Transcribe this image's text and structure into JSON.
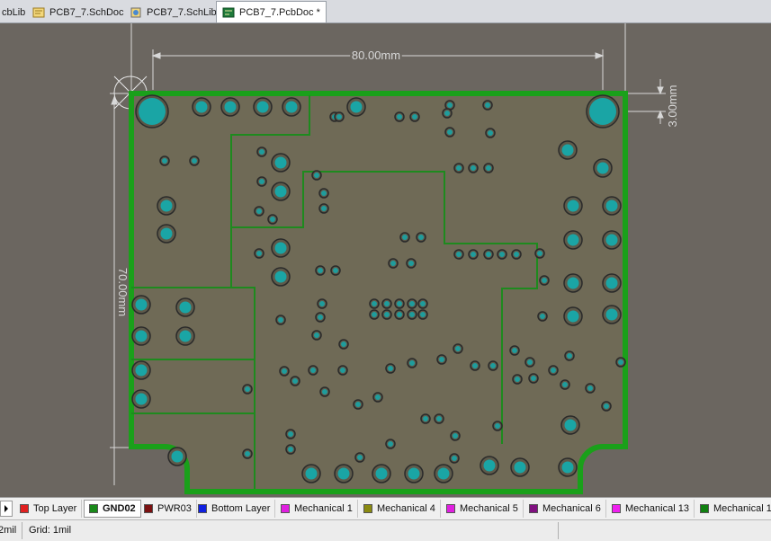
{
  "tabs": [
    {
      "label": "cbLib",
      "icon": "pcb-library-icon",
      "active": false
    },
    {
      "label": "PCB7_7.SchDoc",
      "icon": "schematic-doc-icon",
      "active": false
    },
    {
      "label": "PCB7_7.SchLib",
      "icon": "schematic-library-icon",
      "active": false
    },
    {
      "label": "PCB7_7.PcbDoc *",
      "icon": "pcb-doc-icon",
      "active": true
    }
  ],
  "dimensions": {
    "width": "80.00mm",
    "height": "70.00mm",
    "hole_offset": "3.00mm"
  },
  "colors": {
    "canvas": "#6b6660",
    "board": "#6f6a56",
    "outline": "#1aa01a",
    "plane_split": "#1e8a1e",
    "pad": "#1aa5a5",
    "via": "#1f9c9c",
    "dimension": "#d8d8d8"
  },
  "layers": [
    {
      "label": "Top Layer",
      "color": "#e02020",
      "active": false
    },
    {
      "label": "GND02",
      "color": "#1a8a1a",
      "active": true
    },
    {
      "label": "PWR03",
      "color": "#7a1010",
      "active": false
    },
    {
      "label": "Bottom Layer",
      "color": "#1020e0",
      "active": false
    },
    {
      "label": "Mechanical 1",
      "color": "#e020e0",
      "active": false
    },
    {
      "label": "Mechanical 4",
      "color": "#8a8a10",
      "active": false
    },
    {
      "label": "Mechanical 5",
      "color": "#e020e0",
      "active": false
    },
    {
      "label": "Mechanical 6",
      "color": "#801080",
      "active": false
    },
    {
      "label": "Mechanical 13",
      "color": "#f020f0",
      "active": false
    },
    {
      "label": "Mechanical 1",
      "color": "#108010",
      "active": false
    }
  ],
  "status": {
    "coord": "2mil",
    "grid": "Grid: 1mil"
  }
}
